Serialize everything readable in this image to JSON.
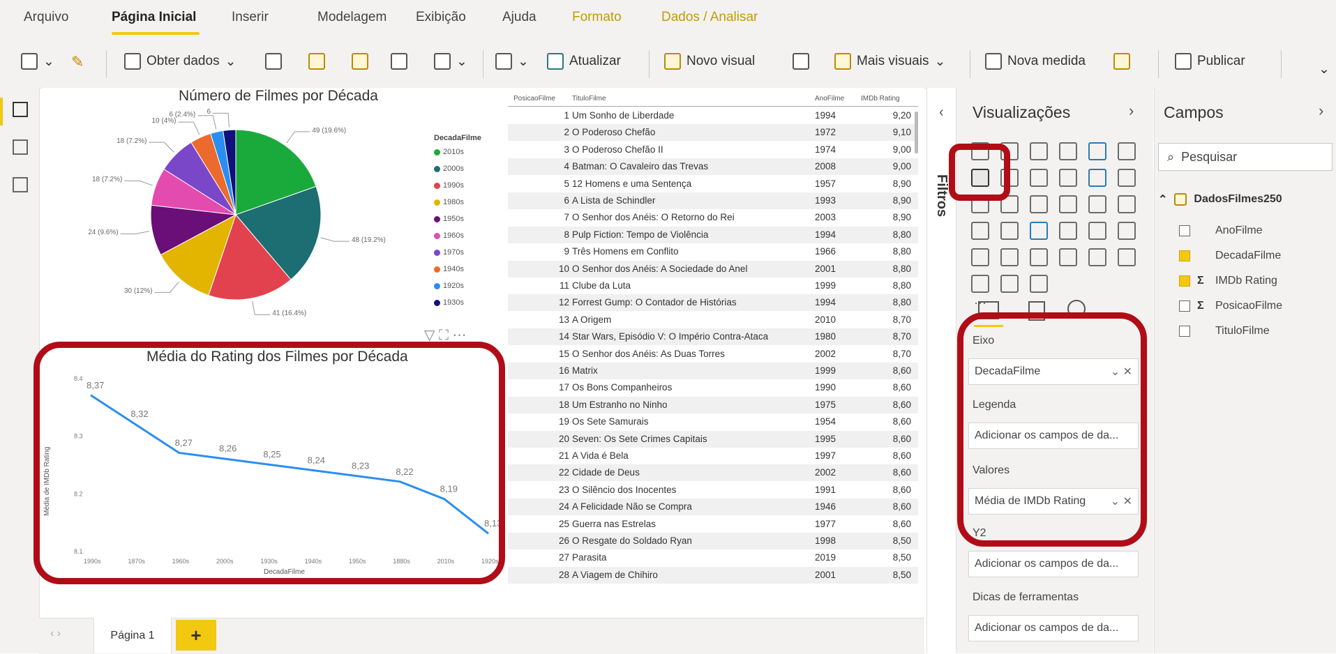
{
  "menu": {
    "items": [
      {
        "label": "Arquivo"
      },
      {
        "label": "Página Inicial"
      },
      {
        "label": "Inserir"
      },
      {
        "label": "Modelagem"
      },
      {
        "label": "Exibição"
      },
      {
        "label": "Ajuda"
      },
      {
        "label": "Formato"
      },
      {
        "label": "Dados / Analisar"
      }
    ]
  },
  "ribbon": {
    "obter_dados": "Obter dados",
    "atualizar": "Atualizar",
    "novo_visual": "Novo visual",
    "mais_visuais": "Mais visuais",
    "nova_medida": "Nova medida",
    "publicar": "Publicar"
  },
  "pie_chart": {
    "title": "Número de Filmes por Década",
    "legend_title": "DecadaFilme",
    "legend": [
      {
        "label": "2010s",
        "color": "#1aaa3c"
      },
      {
        "label": "2000s",
        "color": "#1c6e72"
      },
      {
        "label": "1990s",
        "color": "#e2424e"
      },
      {
        "label": "1980s",
        "color": "#e3b400"
      },
      {
        "label": "1950s",
        "color": "#6a0f78"
      },
      {
        "label": "1960s",
        "color": "#e34cae"
      },
      {
        "label": "1970s",
        "color": "#7b47c9"
      },
      {
        "label": "1940s",
        "color": "#ec6a2d"
      },
      {
        "label": "1920s",
        "color": "#2a8ef0"
      },
      {
        "label": "1930s",
        "color": "#10107a"
      }
    ],
    "labels": [
      {
        "text": "49 (19.6%)"
      },
      {
        "text": "48 (19.2%)"
      },
      {
        "text": "41 (16.4%)"
      },
      {
        "text": "30 (12%)"
      },
      {
        "text": "24 (9.6%)"
      },
      {
        "text": "18 (7.2%)"
      },
      {
        "text": "18 (7.2%)"
      },
      {
        "text": "10 (4%)"
      },
      {
        "text": "6 (2.4%)"
      },
      {
        "text": "6"
      }
    ]
  },
  "line_chart": {
    "title": "Média do Rating dos Filmes por Década",
    "ylabel": "Média de IMDb Rating",
    "xlabel": "DecadaFilme",
    "y_ticks": [
      "8.4",
      "8.3",
      "8.2",
      "8.1"
    ]
  },
  "chart_data": [
    {
      "type": "pie",
      "title": "Número de Filmes por Década",
      "categories": [
        "2010s",
        "2000s",
        "1990s",
        "1980s",
        "1950s",
        "1960s",
        "1970s",
        "1940s",
        "1920s",
        "1930s"
      ],
      "values": [
        49,
        48,
        41,
        30,
        24,
        18,
        18,
        10,
        6,
        6
      ]
    },
    {
      "type": "line",
      "title": "Média do Rating dos Filmes por Década",
      "xlabel": "DecadaFilme",
      "ylabel": "Média de IMDb Rating",
      "categories": [
        "1990s",
        "1870s",
        "1960s",
        "2000s",
        "1930s",
        "1940s",
        "1950s",
        "1880s",
        "2010s",
        "1920s"
      ],
      "values": [
        8.37,
        8.32,
        8.27,
        8.26,
        8.25,
        8.24,
        8.23,
        8.22,
        8.19,
        8.13
      ],
      "labels": [
        "8,37",
        "8,32",
        "8,27",
        "8,26",
        "8,25",
        "8,24",
        "8,23",
        "8,22",
        "8,19",
        "8,13"
      ],
      "ylim": [
        8.1,
        8.4
      ],
      "color": "#2a8ef0"
    }
  ],
  "table": {
    "headers": [
      "PosicaoFilme",
      "TituloFilme",
      "AnoFilme",
      "IMDb Rating"
    ],
    "rows": [
      [
        "1",
        "Um Sonho de Liberdade",
        "1994",
        "9,20"
      ],
      [
        "2",
        "O Poderoso Chefão",
        "1972",
        "9,10"
      ],
      [
        "3",
        "O Poderoso Chefão II",
        "1974",
        "9,00"
      ],
      [
        "4",
        "Batman: O Cavaleiro das Trevas",
        "2008",
        "9,00"
      ],
      [
        "5",
        "12 Homens e uma Sentença",
        "1957",
        "8,90"
      ],
      [
        "6",
        "A Lista de Schindler",
        "1993",
        "8,90"
      ],
      [
        "7",
        "O Senhor dos Anéis: O Retorno do Rei",
        "2003",
        "8,90"
      ],
      [
        "8",
        "Pulp Fiction: Tempo de Violência",
        "1994",
        "8,80"
      ],
      [
        "9",
        "Três Homens em Conflito",
        "1966",
        "8,80"
      ],
      [
        "10",
        "O Senhor dos Anéis: A Sociedade do Anel",
        "2001",
        "8,80"
      ],
      [
        "11",
        "Clube da Luta",
        "1999",
        "8,80"
      ],
      [
        "12",
        "Forrest Gump: O Contador de Histórias",
        "1994",
        "8,80"
      ],
      [
        "13",
        "A Origem",
        "2010",
        "8,70"
      ],
      [
        "14",
        "Star Wars, Episódio V: O Império Contra-Ataca",
        "1980",
        "8,70"
      ],
      [
        "15",
        "O Senhor dos Anéis: As Duas Torres",
        "2002",
        "8,70"
      ],
      [
        "16",
        "Matrix",
        "1999",
        "8,60"
      ],
      [
        "17",
        "Os Bons Companheiros",
        "1990",
        "8,60"
      ],
      [
        "18",
        "Um Estranho no Ninho",
        "1975",
        "8,60"
      ],
      [
        "19",
        "Os Sete Samurais",
        "1954",
        "8,60"
      ],
      [
        "20",
        "Seven: Os Sete Crimes Capitais",
        "1995",
        "8,60"
      ],
      [
        "21",
        "A Vida é Bela",
        "1997",
        "8,60"
      ],
      [
        "22",
        "Cidade de Deus",
        "2002",
        "8,60"
      ],
      [
        "23",
        "O Silêncio dos Inocentes",
        "1991",
        "8,60"
      ],
      [
        "24",
        "A Felicidade Não se Compra",
        "1946",
        "8,60"
      ],
      [
        "25",
        "Guerra nas Estrelas",
        "1977",
        "8,60"
      ],
      [
        "26",
        "O Resgate do Soldado Ryan",
        "1998",
        "8,50"
      ],
      [
        "27",
        "Parasita",
        "2019",
        "8,50"
      ],
      [
        "28",
        "A Viagem de Chihiro",
        "2001",
        "8,50"
      ]
    ]
  },
  "filters": {
    "label": "Filtros"
  },
  "visualizations": {
    "title": "Visualizações",
    "wells": [
      {
        "label": "Eixo",
        "value": "DecadaFilme"
      },
      {
        "label": "Legenda",
        "value": "Adicionar os campos de da..."
      },
      {
        "label": "Valores",
        "value": "Média de IMDb Rating"
      },
      {
        "label": "Y2",
        "value": "Adicionar os campos de da..."
      },
      {
        "label": "Dicas de ferramentas",
        "value": "Adicionar os campos de da..."
      }
    ]
  },
  "fields": {
    "title": "Campos",
    "search_placeholder": "Pesquisar",
    "table_name": "DadosFilmes250",
    "items": [
      {
        "label": "AnoFilme",
        "checked": false,
        "sigma": false
      },
      {
        "label": "DecadaFilme",
        "checked": true,
        "sigma": false
      },
      {
        "label": "IMDb Rating",
        "checked": true,
        "sigma": true
      },
      {
        "label": "PosicaoFilme",
        "checked": false,
        "sigma": true
      },
      {
        "label": "TituloFilme",
        "checked": false,
        "sigma": false
      }
    ]
  },
  "pages": {
    "tab": "Página 1",
    "add": "+"
  },
  "colors": {
    "accent": "#f2c811",
    "highlight": "#b00d17"
  }
}
